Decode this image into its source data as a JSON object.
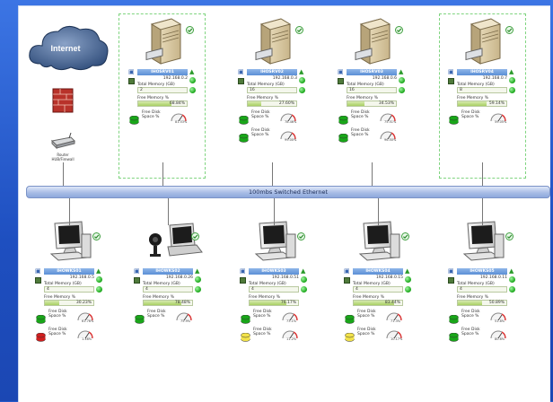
{
  "network": {
    "label": "100mbs Switched Ethernet"
  },
  "internet": {
    "label": "Internet"
  },
  "router": {
    "label_line1": "Router",
    "label_line2": "HUB/Firewall"
  },
  "common": {
    "total_memory_label": "Total Memory (GB)",
    "free_memory_label": "Free Memory %",
    "free_disk_label_1": "Free Disk",
    "free_disk_label_2": "Space %"
  },
  "colors": {
    "accent": "#2458c9",
    "ok": "#19a619",
    "warn": "#f2e24a",
    "error": "#d11f1f",
    "dash": "#7fd47f"
  },
  "servers": [
    {
      "name": "IHOSRV01",
      "ip": "192.168.0.2",
      "total_memory": "2",
      "free_memory": "68.84%",
      "free_memory_pct": 68.84,
      "disks": [
        {
          "status": "ok",
          "value": "81.53%"
        }
      ]
    },
    {
      "name": "IHOSRV02",
      "ip": "192.168.0.3",
      "total_memory": "16",
      "free_memory": "27.60%",
      "free_memory_pct": 27.6,
      "disks": [
        {
          "status": "ok",
          "value": "78.46%"
        },
        {
          "status": "ok",
          "value": "99.00%"
        }
      ]
    },
    {
      "name": "IHOSRV03",
      "ip": "192.168.0.6",
      "total_memory": "16",
      "free_memory": "34.53%",
      "free_memory_pct": 34.53,
      "disks": [
        {
          "status": "ok",
          "value": "75.51%"
        },
        {
          "status": "ok",
          "value": "96.50%"
        }
      ]
    },
    {
      "name": "IHOSRV04",
      "ip": "192.168.0.7",
      "total_memory": "8",
      "free_memory": "59.14%",
      "free_memory_pct": 59.14,
      "disks": [
        {
          "status": "ok",
          "value": "59.05%"
        }
      ]
    }
  ],
  "workstations": [
    {
      "name": "IHOWKS01",
      "ip": "192.168.0.5",
      "total_memory": "4",
      "free_memory": "30.23%",
      "free_memory_pct": 30.23,
      "disks": [
        {
          "status": "ok",
          "value": "61.76%"
        },
        {
          "status": "error",
          "value": "1.46%"
        }
      ]
    },
    {
      "name": "IHOWKS02",
      "ip": "192.168.0.26",
      "total_memory": "4",
      "free_memory": "78.48%",
      "free_memory_pct": 78.48,
      "disks": [
        {
          "status": "ok",
          "value": "75.9%"
        }
      ]
    },
    {
      "name": "IHOWKS03",
      "ip": "192.168.0.51",
      "total_memory": "4",
      "free_memory": "76.17%",
      "free_memory_pct": 76.17,
      "disks": [
        {
          "status": "ok",
          "value": "73.1%"
        },
        {
          "status": "warn",
          "value": "11.2%"
        }
      ]
    },
    {
      "name": "IHOWKS04",
      "ip": "192.168.0.15",
      "total_memory": "4",
      "free_memory": "83.44%",
      "free_memory_pct": 83.44,
      "disks": [
        {
          "status": "ok",
          "value": "71.3%"
        },
        {
          "status": "warn",
          "value": "10.17%"
        }
      ]
    },
    {
      "name": "IHOWKS05",
      "ip": "192.168.0.11",
      "total_memory": "4",
      "free_memory": "50.89%",
      "free_memory_pct": 50.89,
      "disks": [
        {
          "status": "ok",
          "value": "51.8%"
        },
        {
          "status": "ok",
          "value": "80.6%"
        }
      ]
    }
  ]
}
